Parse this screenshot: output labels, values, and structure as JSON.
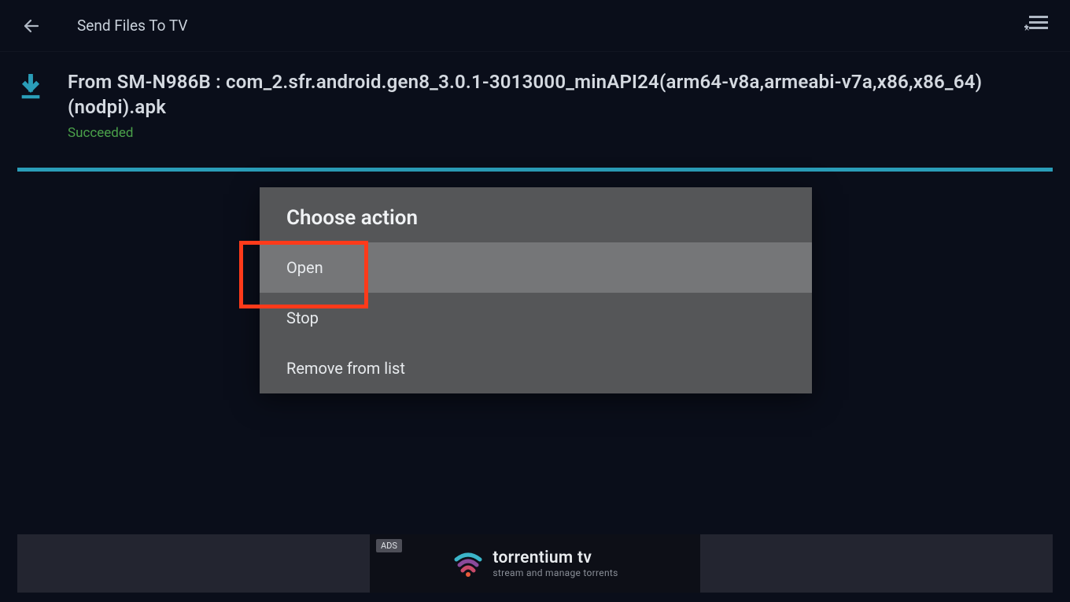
{
  "header": {
    "title": "Send Files To TV"
  },
  "transfer": {
    "label": "From SM-N986B : com_2.sfr.android.gen8_3.0.1-3013000_minAPI24(arm64-v8a,armeabi-v7a,x86,x86_64)(nodpi).apk",
    "status": "Succeeded"
  },
  "dialog": {
    "title": "Choose action",
    "items": [
      {
        "label": "Open"
      },
      {
        "label": "Stop"
      },
      {
        "label": "Remove from list"
      }
    ]
  },
  "ad": {
    "badge": "ADS",
    "title": "torrentium tv",
    "subtitle": "stream and manage torrents"
  },
  "colors": {
    "accent": "#2a9db8",
    "success": "#4aa04a",
    "highlight": "#ff3a1a"
  }
}
